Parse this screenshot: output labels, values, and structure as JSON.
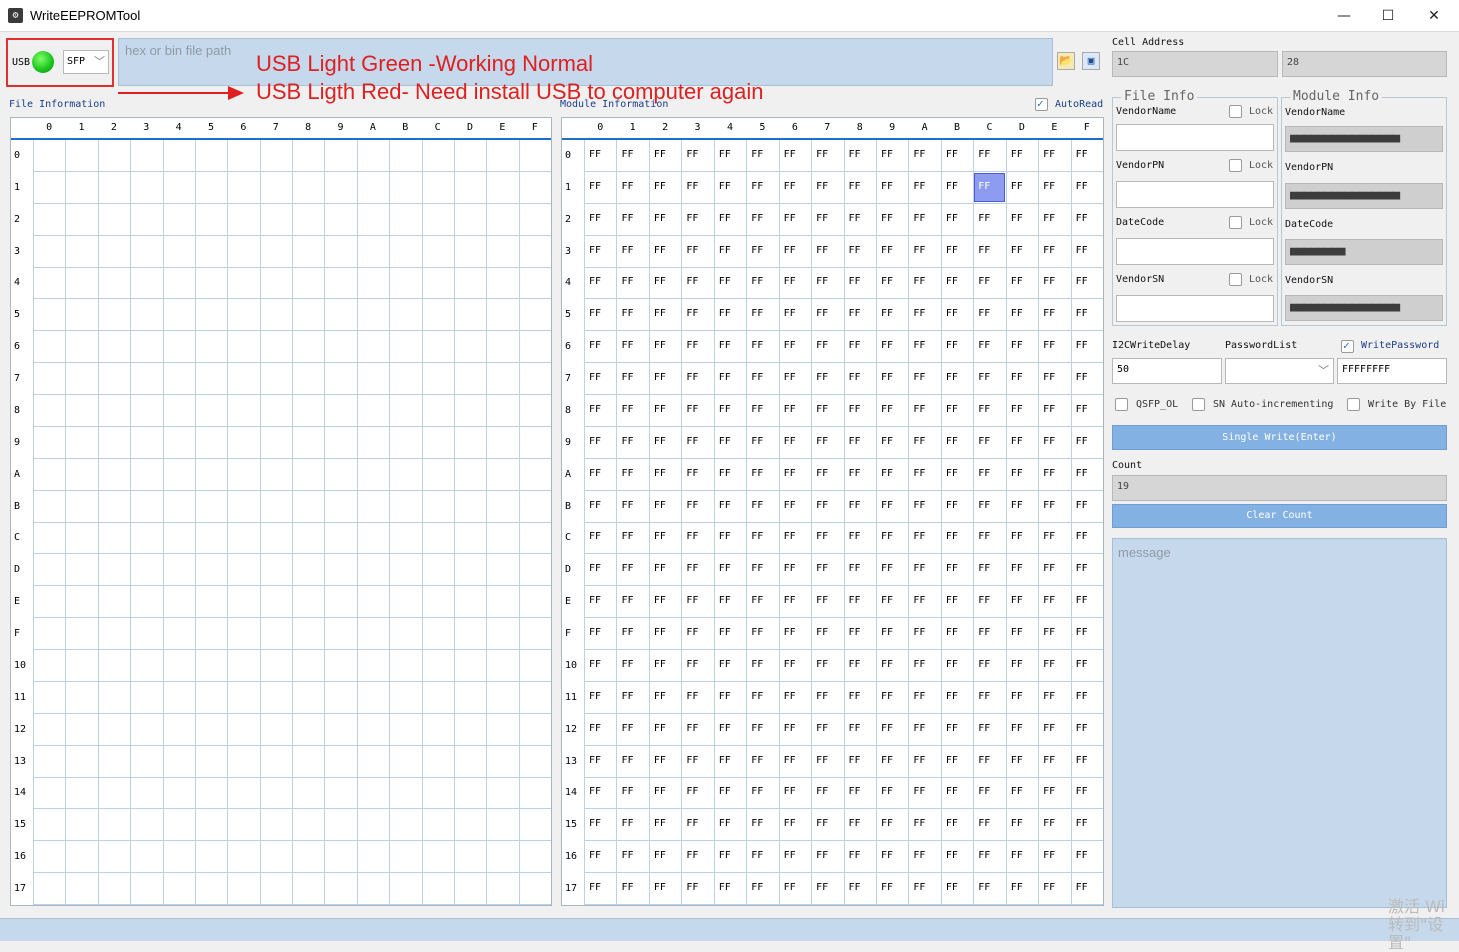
{
  "window": {
    "title": "WriteEEPROMTool",
    "icon": "gear-icon",
    "minimize": "—",
    "maximize": "☐",
    "close": "✕"
  },
  "usb": {
    "label": "USB",
    "status_color": "#22c322",
    "port_type": "SFP",
    "chevron": "﹀"
  },
  "path_input": {
    "placeholder": "hex or bin file path",
    "value": ""
  },
  "annotations": {
    "line1": "USB Light Green -Working Normal",
    "line2": "USB Ligth Red- Need install USB to computer again"
  },
  "file_info": {
    "label": "File Information",
    "col_headers": [
      "0",
      "1",
      "2",
      "3",
      "4",
      "5",
      "6",
      "7",
      "8",
      "9",
      "A",
      "B",
      "C",
      "D",
      "E",
      "F"
    ],
    "row_headers": [
      "0",
      "1",
      "2",
      "3",
      "4",
      "5",
      "6",
      "7",
      "8",
      "9",
      "A",
      "B",
      "C",
      "D",
      "E",
      "F",
      "10",
      "11",
      "12",
      "13",
      "14",
      "15",
      "16",
      "17"
    ]
  },
  "module_info_grid": {
    "label": "Module Information",
    "autoread_label": "AutoRead",
    "autoread_checked": true,
    "col_headers": [
      "0",
      "1",
      "2",
      "3",
      "4",
      "5",
      "6",
      "7",
      "8",
      "9",
      "A",
      "B",
      "C",
      "D",
      "E",
      "F"
    ],
    "row_headers": [
      "0",
      "1",
      "2",
      "3",
      "4",
      "5",
      "6",
      "7",
      "8",
      "9",
      "A",
      "B",
      "C",
      "D",
      "E",
      "F",
      "10",
      "11",
      "12",
      "13",
      "14",
      "15",
      "16",
      "17"
    ],
    "cell_value": "FF",
    "selected_cell": {
      "row": "1",
      "col": "C"
    }
  },
  "cell_address": {
    "label": "Cell Address",
    "left_value": "1C",
    "right_value": "28"
  },
  "file_info_group": {
    "title": "File Info",
    "lock_label": "Lock",
    "fields": [
      {
        "label": "VendorName",
        "value": ""
      },
      {
        "label": "VendorPN",
        "value": ""
      },
      {
        "label": "DateCode",
        "value": ""
      },
      {
        "label": "VendorSN",
        "value": ""
      }
    ]
  },
  "module_info_group": {
    "title": "Module Info",
    "fields": [
      {
        "label": "VendorName",
        "value": "■■■■■■■■■■■■■■■■"
      },
      {
        "label": "VendorPN",
        "value": "■■■■■■■■■■■■■■■■"
      },
      {
        "label": "DateCode",
        "value": "■■■■■■■■"
      },
      {
        "label": "VendorSN",
        "value": "■■■■■■■■■■■■■■■■"
      }
    ]
  },
  "write_settings": {
    "delay_label": "I2CWriteDelay",
    "delay_value": "50",
    "password_list_label": "PasswordList",
    "password_list_value": "",
    "write_password_label": "WritePassword",
    "write_password_checked": true,
    "password_value": "FFFFFFFF"
  },
  "options": {
    "qsfp_ol": "QSFP_OL",
    "sn_auto": "SN Auto-incrementing",
    "write_by_file": "Write By File"
  },
  "actions": {
    "single_write": "Single Write(Enter)",
    "count_label": "Count",
    "count_value": "19",
    "clear_count": "Clear Count"
  },
  "message": {
    "placeholder": "message"
  },
  "watermark": {
    "line1": "激活 Wi",
    "line2": "转到\"设置\""
  }
}
